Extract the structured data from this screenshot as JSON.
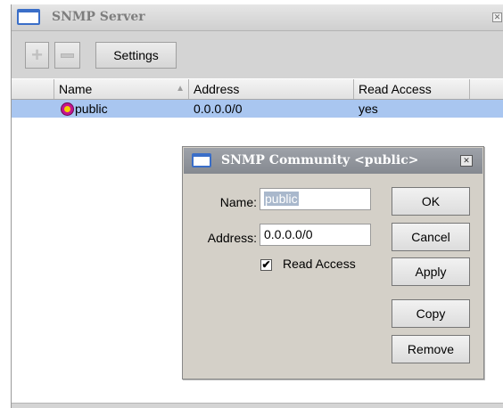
{
  "main": {
    "title": "SNMP Server",
    "toolbar": {
      "add_icon": "plus-icon",
      "remove_icon": "minus-icon",
      "settings_label": "Settings"
    },
    "table": {
      "columns": [
        "Name",
        "Address",
        "Read Access"
      ],
      "rows": [
        {
          "icon": "community-icon",
          "name": "public",
          "address": "0.0.0.0/0",
          "read_access": "yes"
        }
      ]
    }
  },
  "dialog": {
    "title": "SNMP Community <public>",
    "name_label": "Name:",
    "name_value": "public",
    "address_label": "Address:",
    "address_value": "0.0.0.0/0",
    "read_access_label": "Read Access",
    "read_access_checked": true,
    "buttons": {
      "ok": "OK",
      "cancel": "Cancel",
      "apply": "Apply",
      "copy": "Copy",
      "remove": "Remove"
    }
  },
  "colors": {
    "selection": "#a9c6f0",
    "title_accent": "#3a6ec8",
    "community_icon": "#c4168f"
  }
}
